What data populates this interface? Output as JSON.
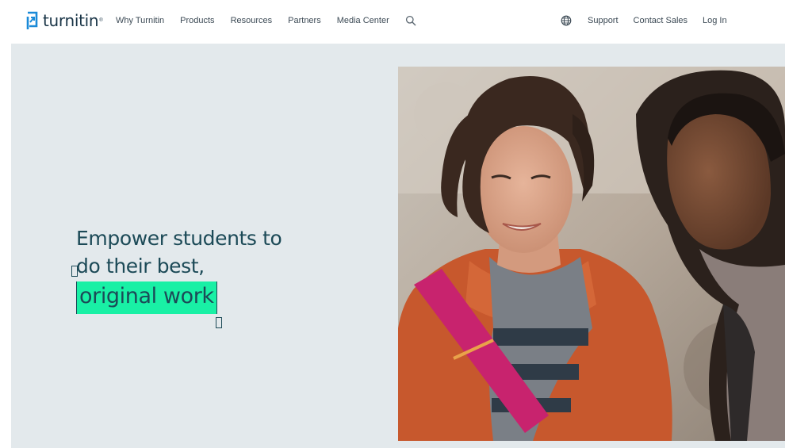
{
  "brand": {
    "logo_text": "turnitin",
    "trademark": "®"
  },
  "nav": {
    "left": [
      {
        "label": "Why Turnitin"
      },
      {
        "label": "Products"
      },
      {
        "label": "Resources"
      },
      {
        "label": "Partners"
      },
      {
        "label": "Media Center"
      }
    ],
    "search_icon": "search-icon",
    "globe_icon": "globe-icon",
    "right": [
      {
        "label": "Support"
      },
      {
        "label": "Contact Sales"
      },
      {
        "label": "Log In"
      }
    ]
  },
  "hero": {
    "headline_line1": "Empower students to",
    "headline_line2": "do their best,",
    "headline_highlight": "original work",
    "photo_subject": "two students looking down outdoors"
  },
  "colors": {
    "brand_blue": "#1a8ad8",
    "text_dark": "#1c4a57",
    "highlight": "#19f0a5",
    "hero_bg": "#e3e9ec"
  }
}
